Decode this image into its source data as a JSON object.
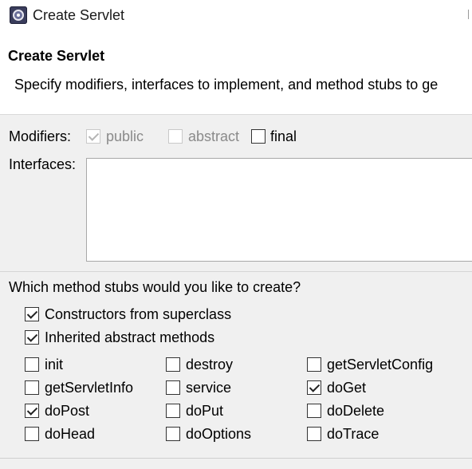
{
  "window": {
    "title": "Create Servlet"
  },
  "header": {
    "title": "Create Servlet",
    "description": "Specify modifiers, interfaces to implement, and method stubs to ge"
  },
  "modifiers": {
    "label": "Modifiers:",
    "public": {
      "label": "public",
      "checked": true,
      "enabled": false
    },
    "abstract": {
      "label": "abstract",
      "checked": false,
      "enabled": false
    },
    "final": {
      "label": "final",
      "checked": false,
      "enabled": true
    }
  },
  "interfaces": {
    "label": "Interfaces:",
    "items": []
  },
  "stubs": {
    "question": "Which method stubs would you like to create?",
    "constructors": {
      "label": "Constructors from superclass",
      "checked": true
    },
    "inherited": {
      "label": "Inherited abstract methods",
      "checked": true
    },
    "methods": [
      {
        "label": "init",
        "checked": false
      },
      {
        "label": "destroy",
        "checked": false
      },
      {
        "label": "getServletConfig",
        "checked": false
      },
      {
        "label": "getServletInfo",
        "checked": false
      },
      {
        "label": "service",
        "checked": false
      },
      {
        "label": "doGet",
        "checked": true
      },
      {
        "label": "doPost",
        "checked": true
      },
      {
        "label": "doPut",
        "checked": false
      },
      {
        "label": "doDelete",
        "checked": false
      },
      {
        "label": "doHead",
        "checked": false
      },
      {
        "label": "doOptions",
        "checked": false
      },
      {
        "label": "doTrace",
        "checked": false
      }
    ]
  }
}
